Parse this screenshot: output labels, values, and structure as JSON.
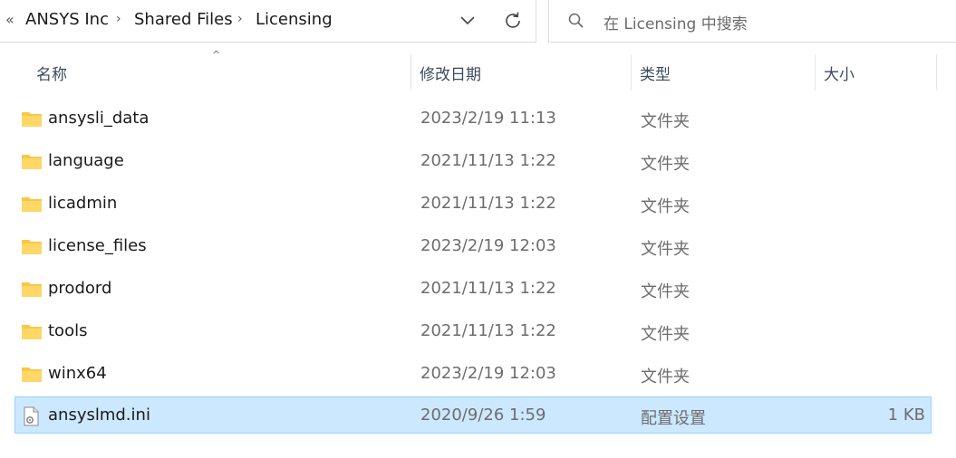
{
  "breadcrumb": {
    "items": [
      "ANSYS Inc",
      "Shared Files",
      "Licensing"
    ]
  },
  "search": {
    "placeholder": "在 Licensing 中搜索"
  },
  "columns": {
    "name": "名称",
    "modified": "修改日期",
    "type": "类型",
    "size": "大小"
  },
  "files": [
    {
      "name": "ansysli_data",
      "modified": "2023/2/19 11:13",
      "type": "文件夹",
      "size": "",
      "kind": "folder"
    },
    {
      "name": "language",
      "modified": "2021/11/13 1:22",
      "type": "文件夹",
      "size": "",
      "kind": "folder"
    },
    {
      "name": "licadmin",
      "modified": "2021/11/13 1:22",
      "type": "文件夹",
      "size": "",
      "kind": "folder"
    },
    {
      "name": "license_files",
      "modified": "2023/2/19 12:03",
      "type": "文件夹",
      "size": "",
      "kind": "folder"
    },
    {
      "name": "prodord",
      "modified": "2021/11/13 1:22",
      "type": "文件夹",
      "size": "",
      "kind": "folder"
    },
    {
      "name": "tools",
      "modified": "2021/11/13 1:22",
      "type": "文件夹",
      "size": "",
      "kind": "folder"
    },
    {
      "name": "winx64",
      "modified": "2023/2/19 12:03",
      "type": "文件夹",
      "size": "",
      "kind": "folder"
    },
    {
      "name": "ansyslmd.ini",
      "modified": "2020/9/26 1:59",
      "type": "配置设置",
      "size": "1 KB",
      "kind": "ini-file",
      "selected": true
    }
  ],
  "icons": {
    "folder": "folder-icon",
    "ini": "ini-file-icon",
    "search": "search-icon",
    "refresh": "refresh-icon",
    "dropdown": "chevron-down-icon"
  },
  "colors": {
    "selection_bg": "#cce8ff",
    "selection_border": "#99d1ff",
    "folder": "#f8c846"
  }
}
